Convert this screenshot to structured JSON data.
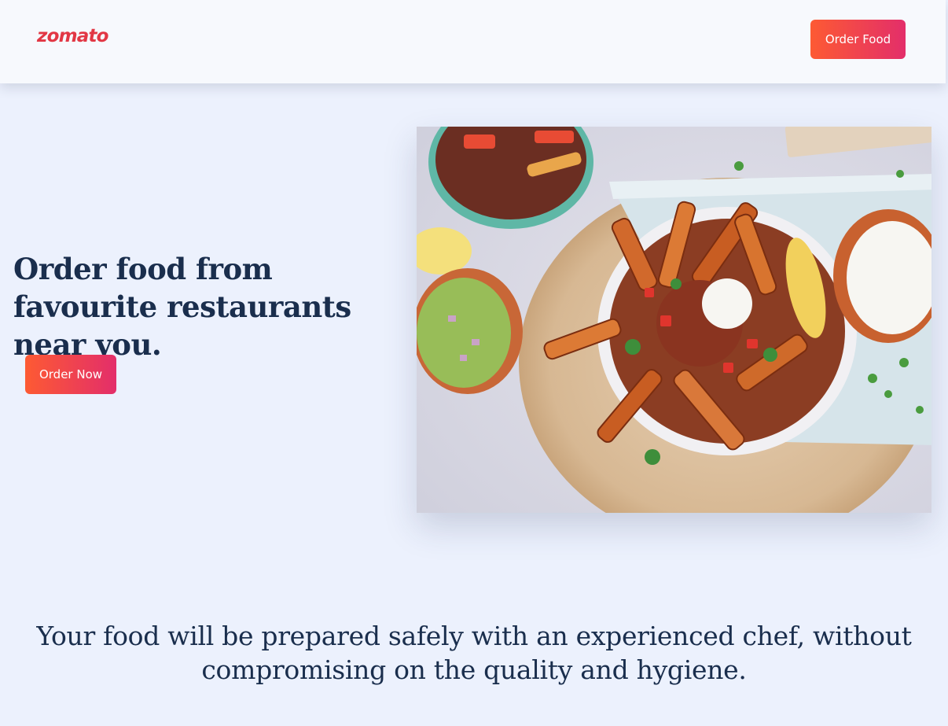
{
  "header": {
    "logo_text": "zomato",
    "order_food_label": "Order Food"
  },
  "hero": {
    "title": "Order food from favourite restaurants near you.",
    "order_now_label": "Order Now",
    "image_icon": "food-platter-photo"
  },
  "tagline": "Your food will be prepared safely with an experienced chef, without compromising on the quality and hygiene.",
  "colors": {
    "brand": "#e23744",
    "button_gradient_start": "#fd5a33",
    "button_gradient_end": "#e32e6a",
    "heading": "#1a2e4d",
    "background": "#ecf1fd"
  }
}
